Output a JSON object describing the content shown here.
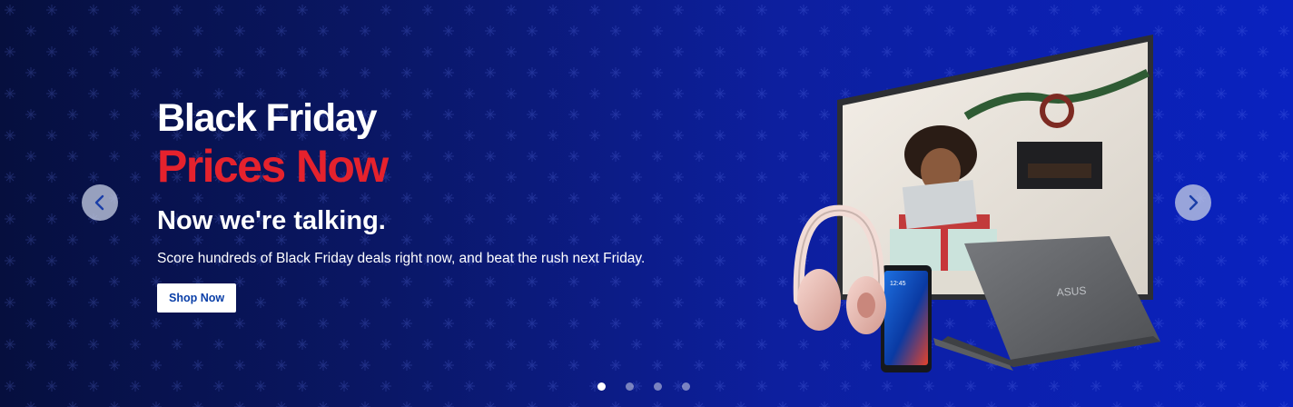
{
  "hero": {
    "headline_line1": "Black Friday",
    "headline_line2": "Prices Now",
    "subheadline": "Now we're talking.",
    "body": "Score hundreds of Black Friday deals right now, and beat the rush next Friday.",
    "cta_label": "Shop Now",
    "accent_color": "#e5222d",
    "background_color": "#0a1766"
  },
  "products": {
    "laptop_logo": "ASUS",
    "phone_time": "12:45"
  },
  "carousel": {
    "prev_icon": "chevron-left-icon",
    "next_icon": "chevron-right-icon",
    "slide_count": 4,
    "active_slide": 1
  }
}
